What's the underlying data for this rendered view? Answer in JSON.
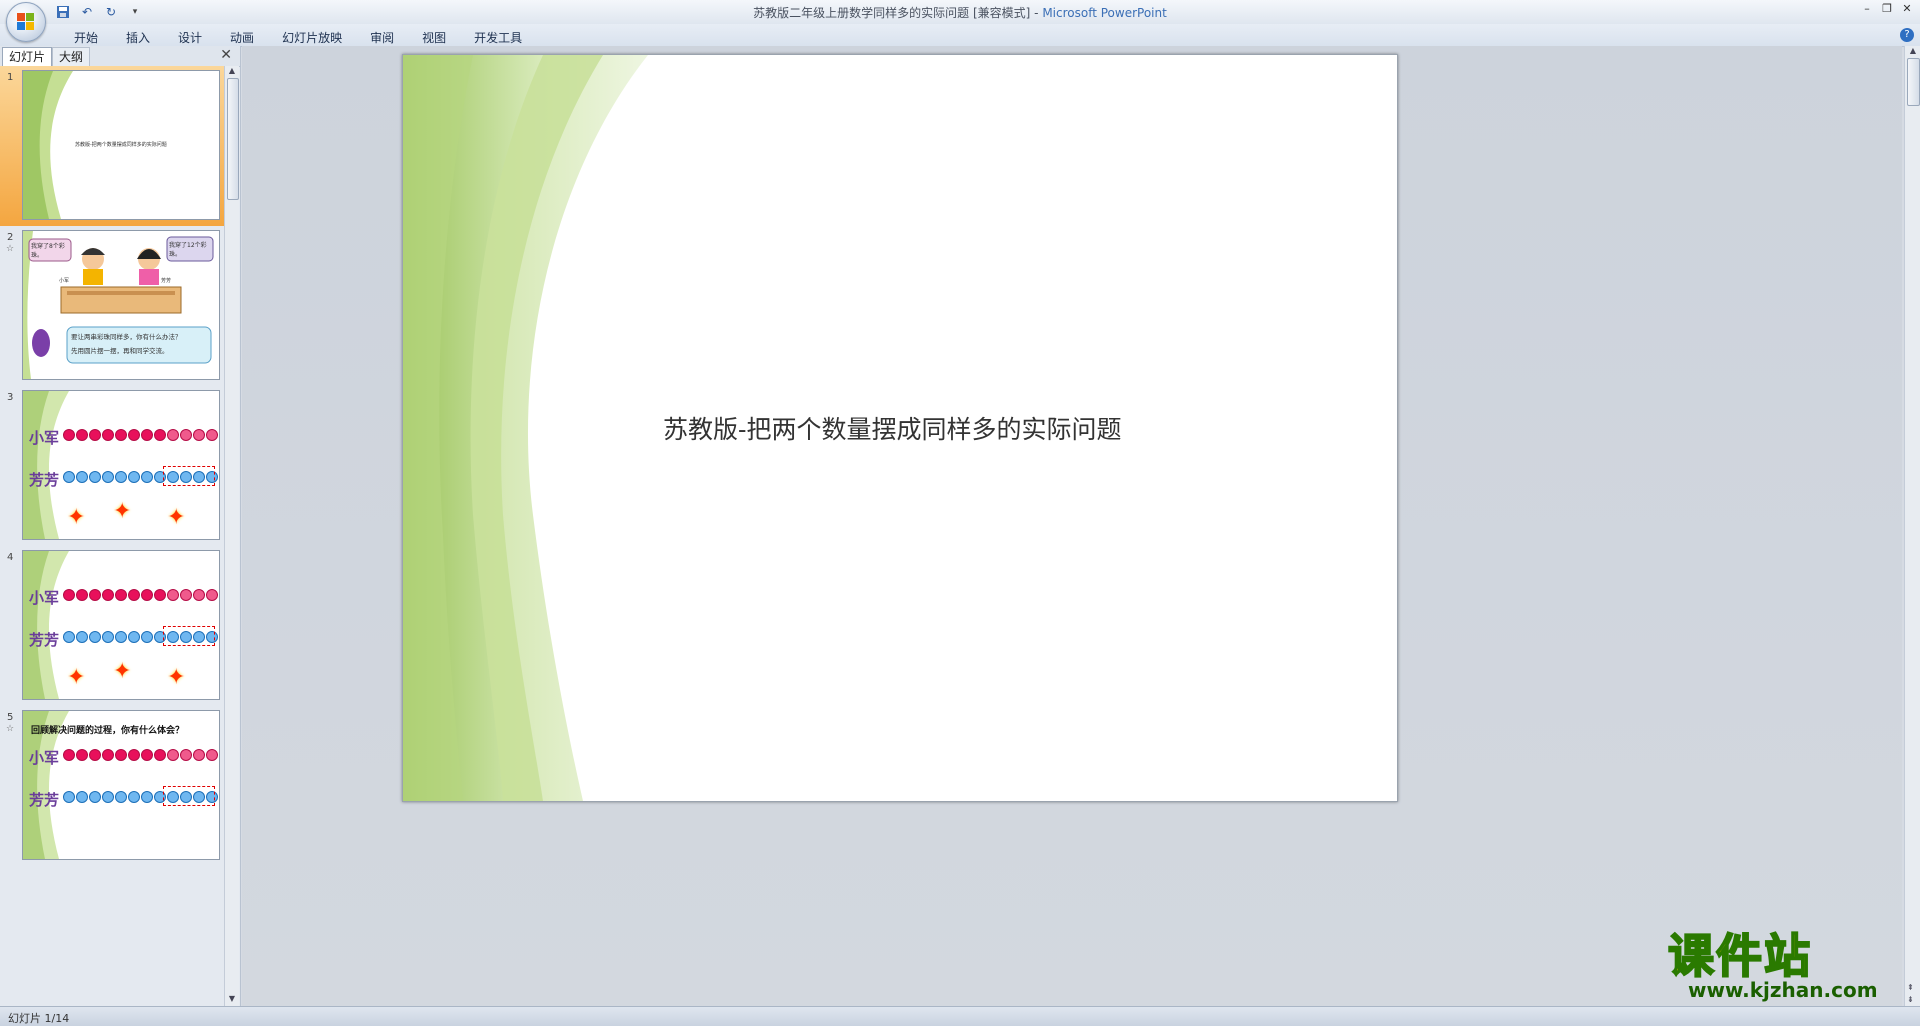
{
  "window": {
    "title": "苏教版二年级上册数学同样多的实际问题 [兼容模式] - ",
    "app_name": "Microsoft PowerPoint"
  },
  "ribbon": {
    "tabs": [
      "开始",
      "插入",
      "设计",
      "动画",
      "幻灯片放映",
      "审阅",
      "视图",
      "开发工具"
    ]
  },
  "panel": {
    "tab_slides": "幻灯片",
    "tab_outline": "大纲"
  },
  "thumbnails": {
    "slide1": {
      "num": "1",
      "text": "苏教版-把两个数量摆成同样多的实际问题"
    },
    "slide2": {
      "num": "2",
      "bubble_left": "我穿了8个彩珠。",
      "bubble_right": "我穿了12个彩珠。",
      "name_left": "小军",
      "name_right": "芳芳",
      "bubble_bottom_1": "要让两串彩珠同样多，你有什么办法？",
      "bubble_bottom_2": "先用圆片摆一摆，再和同学交流。"
    },
    "slide3": {
      "num": "3",
      "row1": "小军",
      "row2": "芳芳"
    },
    "slide4": {
      "num": "4",
      "row1": "小军",
      "row2": "芳芳"
    },
    "slide5": {
      "num": "5",
      "heading": "回顾解决问题的过程，你有什么体会？",
      "row1": "小军",
      "row2": "芳芳"
    }
  },
  "slide": {
    "title": "苏教版-把两个数量摆成同样多的实际问题"
  },
  "status": {
    "slide_counter": "幻灯片 1/14"
  },
  "watermark": {
    "main": "课件站",
    "url": "www.kjzhan.com"
  },
  "colors": {
    "ribbon_text": "#1e3150",
    "selected_thumb": "#f4a640",
    "green_wave": "#a9cc6a"
  }
}
